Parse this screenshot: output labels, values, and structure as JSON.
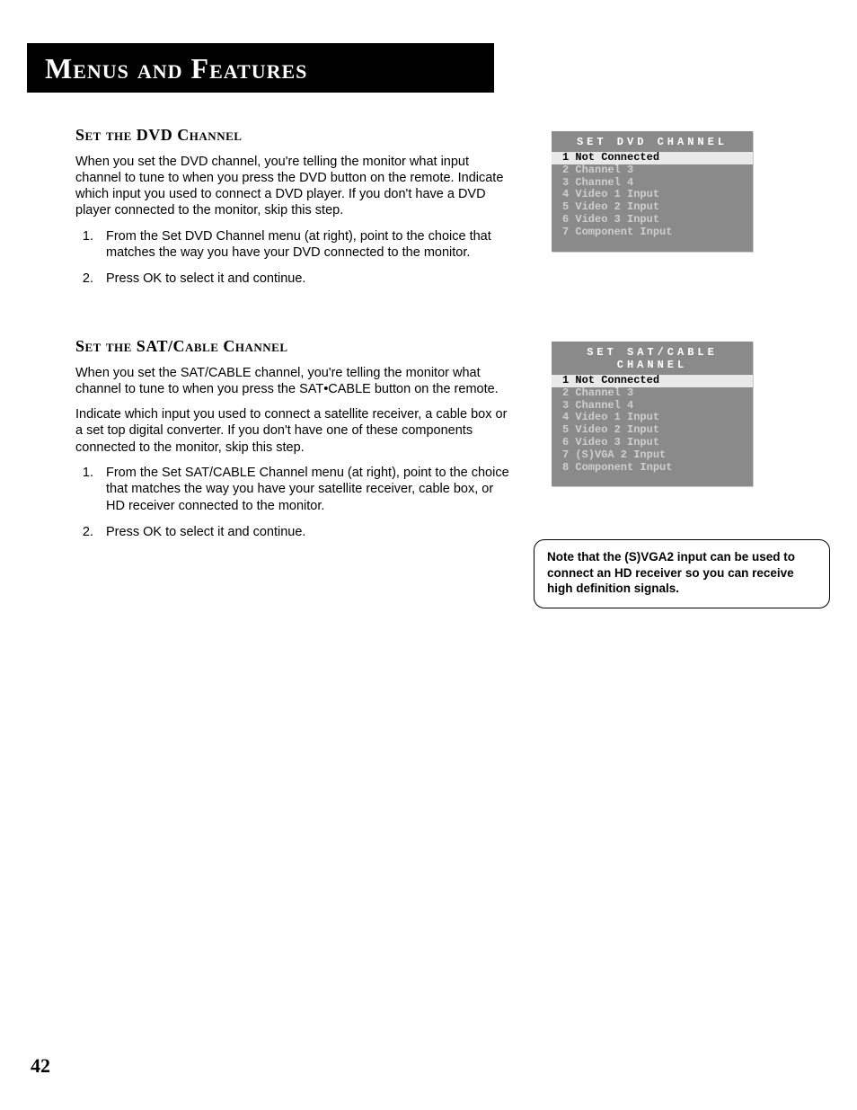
{
  "title": "Menus and Features",
  "page_number": "42",
  "dvd": {
    "heading": "Set the DVD Channel",
    "p1": "When you set the DVD channel, you're telling the monitor what input channel to tune to when you press the DVD button on the remote. Indicate which input you used to connect a DVD player. If you don't have a DVD player connected to the monitor, skip this step.",
    "step1": "From the Set DVD Channel menu (at right), point to the choice  that matches the way you have your DVD connected to the monitor.",
    "step2": "Press OK to select it and continue.",
    "menu": {
      "header": "SET DVD CHANNEL",
      "items": [
        "1 Not Connected",
        "2 Channel 3",
        "3 Channel 4",
        "4 Video 1 Input",
        "5 Video 2 Input",
        "6 Video 3 Input",
        "7 Component Input"
      ]
    }
  },
  "sat": {
    "heading": "Set the SAT/Cable Channel",
    "p1": "When you set the SAT/CABLE channel, you're telling the monitor what channel to tune to when you press the SAT•CABLE button on the remote.",
    "p2": "Indicate which input you used to connect a satellite receiver, a cable box or a set top digital converter. If you don't have one of these components connected to the monitor, skip this step.",
    "step1": "From the Set SAT/CABLE Channel menu (at right), point to the choice that matches the way you have your satellite receiver, cable box, or HD receiver connected to the monitor.",
    "step2": "Press OK to select it and continue.",
    "menu": {
      "header": "SET SAT/CABLE CHANNEL",
      "items": [
        "1 Not Connected",
        "2 Channel 3",
        "3 Channel 4",
        "4 Video 1 Input",
        "5 Video 2 Input",
        "6 Video 3 Input",
        "7 (S)VGA 2 Input",
        "8 Component Input"
      ]
    }
  },
  "note": "Note that the (S)VGA2 input can be used to connect an HD receiver so you can receive high definition signals."
}
